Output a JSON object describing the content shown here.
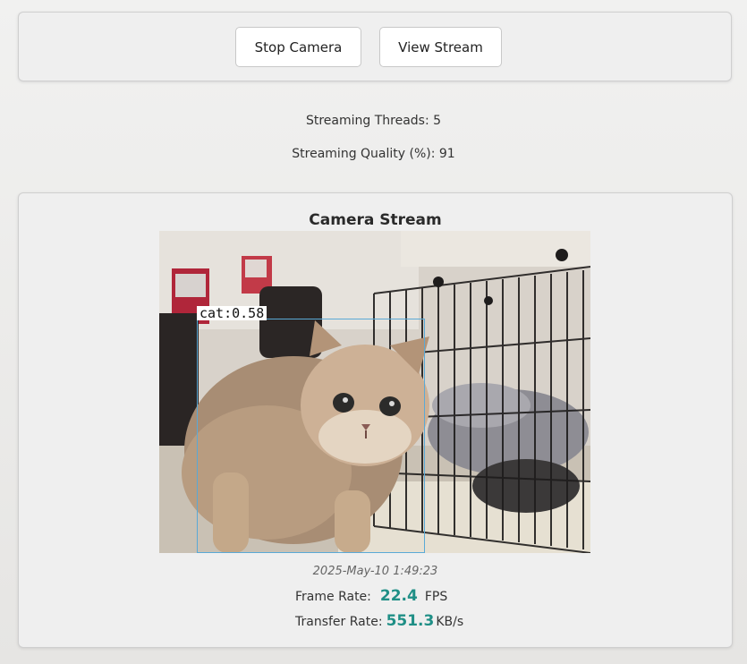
{
  "controls": {
    "stop_camera_label": "Stop Camera",
    "view_stream_label": "View Stream"
  },
  "settings": {
    "threads": "Streaming Threads: 5",
    "quality": "Streaming Quality (%): 91"
  },
  "stream": {
    "title": "Camera Stream",
    "detection_label": "cat:0.58",
    "timestamp": "2025-May-10 1:49:23",
    "frame_rate_label": "Frame Rate:",
    "frame_rate_value": "22.4",
    "frame_rate_unit": "FPS",
    "transfer_rate_label": "Transfer Rate:",
    "transfer_rate_value": "551.3",
    "transfer_rate_unit": "KB/s"
  },
  "colors": {
    "accent": "#1f8f86",
    "detection_box": "#5aa9d6"
  }
}
